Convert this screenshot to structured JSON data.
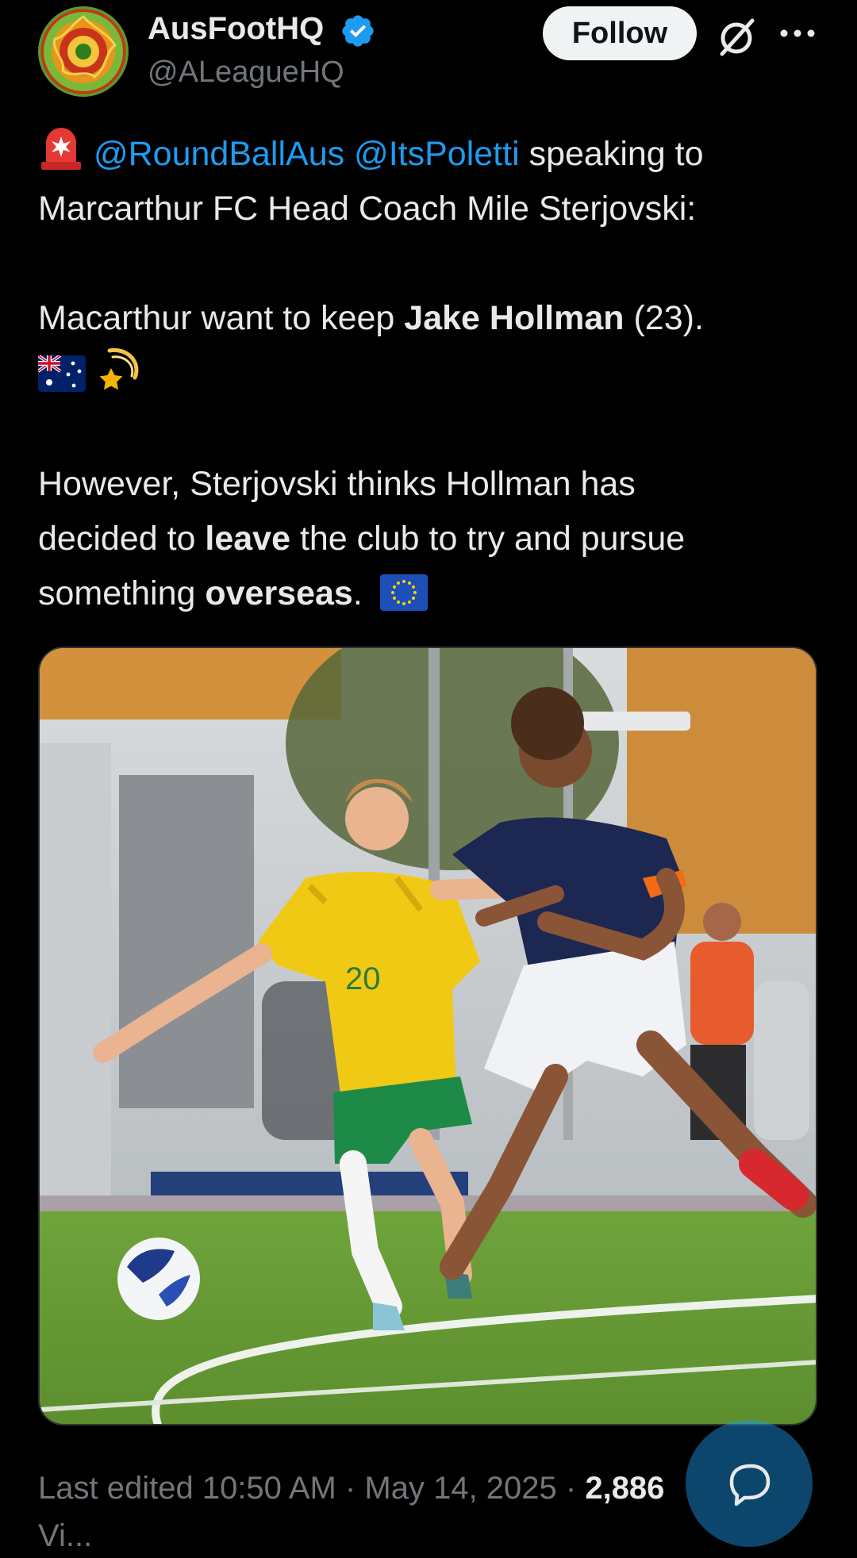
{
  "author": {
    "name": "AusFootHQ",
    "handle": "@ALeagueHQ",
    "verified": true
  },
  "actions": {
    "follow_label": "Follow",
    "grok_icon": "grok-slash-icon",
    "more_icon": "more-dots-icon"
  },
  "post": {
    "line1_mention1": "@RoundBallAus",
    "line1_mention2": "@ItsPoletti",
    "line1_text": " speaking to",
    "line2": "Marcarthur FC Head Coach Mile Sterjovski:",
    "p2_prefix": "Macarthur want to keep ",
    "p2_bold": "Jake Hollman",
    "p2_suffix": " (23).",
    "p3_part1": "However, Sterjovski thinks Hollman has",
    "p3_part2_prefix": "decided to ",
    "p3_part2_bold": "leave",
    "p3_part2_suffix": " the club to try and pursue",
    "p3_part3_prefix": "something ",
    "p3_part3_bold": "overseas",
    "p3_part3_suffix": ".",
    "emojis": [
      "police-light-emoji",
      "australia-flag-emoji",
      "shooting-star-emoji",
      "eu-flag-emoji"
    ]
  },
  "media": {
    "description_icon": "football-photo",
    "jersey_number": "20"
  },
  "meta": {
    "prefix": "Last edited ",
    "time": "10:50 AM",
    "separator": " · ",
    "date": "May 14, 2025",
    "views_count": "2,886",
    "views_label": "Vi..."
  },
  "colors": {
    "accent": "#1d9bf0",
    "background": "#000000",
    "text": "#e7e9ea",
    "muted": "#71767b"
  }
}
